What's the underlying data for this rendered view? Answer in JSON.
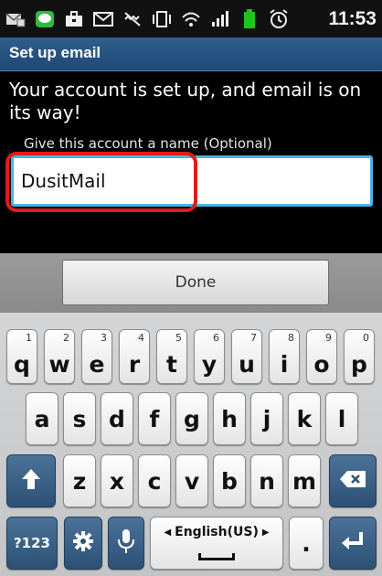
{
  "status_bar": {
    "time": "11:53",
    "icons": [
      "email-icon",
      "line-app-icon",
      "briefcase-icon",
      "mail-icon",
      "vibrate-icon",
      "nfc-icon",
      "wifi-icon",
      "signal-icon",
      "battery-icon",
      "alarm-icon"
    ]
  },
  "title_bar": {
    "title": "Set up email"
  },
  "content": {
    "message": "Your account is set up, and email is on its way!",
    "field_label": "Give this account a name (Optional)",
    "account_name_value": "DusitMail"
  },
  "actions": {
    "done_label": "Done"
  },
  "keyboard": {
    "row1": [
      {
        "key": "q",
        "alt": "1"
      },
      {
        "key": "w",
        "alt": "2"
      },
      {
        "key": "e",
        "alt": "3"
      },
      {
        "key": "r",
        "alt": "4"
      },
      {
        "key": "t",
        "alt": "5"
      },
      {
        "key": "y",
        "alt": "6"
      },
      {
        "key": "u",
        "alt": "7"
      },
      {
        "key": "i",
        "alt": "8"
      },
      {
        "key": "o",
        "alt": "9"
      },
      {
        "key": "p",
        "alt": "0"
      }
    ],
    "row2": [
      "a",
      "s",
      "d",
      "f",
      "g",
      "h",
      "j",
      "k",
      "l"
    ],
    "row3": [
      "z",
      "x",
      "c",
      "v",
      "b",
      "n",
      "m"
    ],
    "symbols_label": "?123",
    "language_label": "English(US)",
    "period_label": ".",
    "colors": {
      "accent": "#48b5e8",
      "highlight": "#e21a1a",
      "function_key": "#3b6187"
    }
  }
}
